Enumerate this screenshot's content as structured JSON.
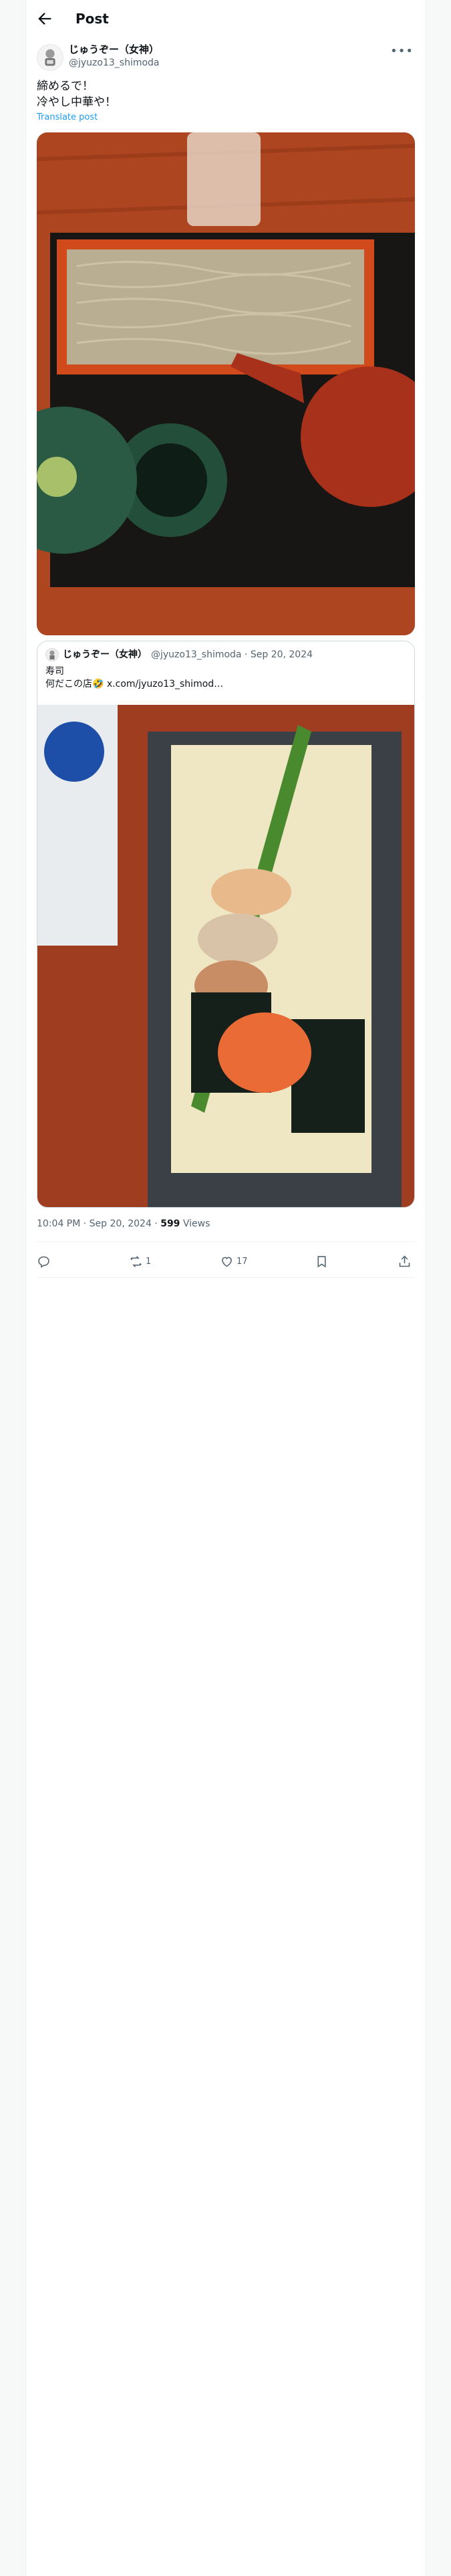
{
  "header": {
    "title": "Post"
  },
  "author": {
    "display_name": "じゅうぞー（女神）",
    "handle": "@jyuzo13_shimoda"
  },
  "post": {
    "text": "締めるで！\n冷やし中華や！",
    "translate_label": "Translate post"
  },
  "quote": {
    "display_name": "じゅうぞー（女神）",
    "handle_date": "@jyuzo13_shimoda · Sep 20, 2024",
    "text": "寿司\n何だこの店🤣 x.com/jyuzo13_shimod…"
  },
  "meta": {
    "time_date": "10:04 PM · Sep 20, 2024 · ",
    "views_count": "599",
    "views_label": " Views"
  },
  "actions": {
    "reply_count": "",
    "repost_count": "1",
    "like_count": "17"
  },
  "icons": [
    "back-arrow-icon",
    "more-icon",
    "reply-icon",
    "repost-icon",
    "like-icon",
    "bookmark-icon",
    "share-icon"
  ]
}
